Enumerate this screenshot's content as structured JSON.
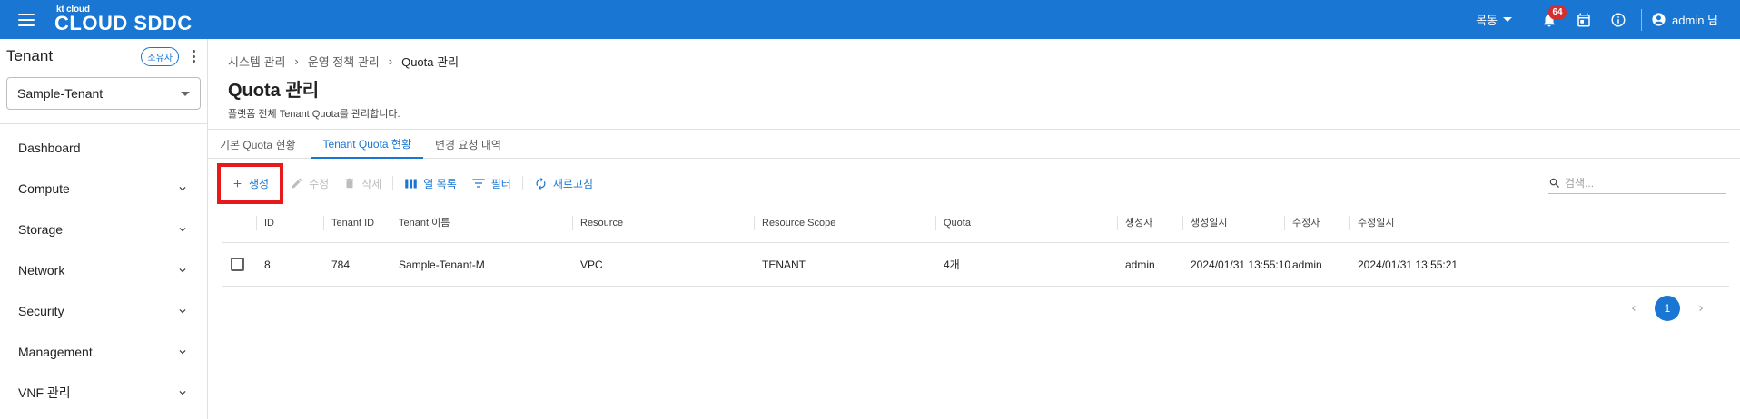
{
  "header": {
    "logo_small": "kt cloud",
    "logo_main": "CLOUD SDDC",
    "region": "목동",
    "notification_count": "64",
    "user_label": "admin 님"
  },
  "sidebar": {
    "title": "Tenant",
    "owner_chip": "소유자",
    "tenant_selected": "Sample-Tenant",
    "items": [
      {
        "label": "Dashboard",
        "expandable": false
      },
      {
        "label": "Compute",
        "expandable": true
      },
      {
        "label": "Storage",
        "expandable": true
      },
      {
        "label": "Network",
        "expandable": true
      },
      {
        "label": "Security",
        "expandable": true
      },
      {
        "label": "Management",
        "expandable": true
      },
      {
        "label": "VNF 관리",
        "expandable": true
      }
    ]
  },
  "breadcrumb": [
    "시스템 관리",
    "운영 정책 관리",
    "Quota 관리"
  ],
  "page": {
    "title": "Quota 관리",
    "description": "플랫폼 전체 Tenant Quota를 관리합니다."
  },
  "tabs": [
    "기본 Quota 현황",
    "Tenant Quota 현황",
    "변경 요청 내역"
  ],
  "toolbar": {
    "create": "생성",
    "edit": "수정",
    "delete": "삭제",
    "columns": "열 목록",
    "filter": "필터",
    "refresh": "새로고침",
    "search_placeholder": "검색..."
  },
  "table": {
    "columns": [
      "ID",
      "Tenant ID",
      "Tenant 이름",
      "Resource",
      "Resource Scope",
      "Quota",
      "생성자",
      "생성일시",
      "수정자",
      "수정일시"
    ],
    "rows": [
      [
        "8",
        "784",
        "Sample-Tenant-M",
        "VPC",
        "TENANT",
        "4개",
        "admin",
        "2024/01/31 13:55:10",
        "admin",
        "2024/01/31 13:55:21"
      ]
    ]
  },
  "pagination": {
    "current": "1"
  },
  "colors": {
    "primary": "#1976d2",
    "highlight": "#e8191d",
    "badge": "#d32f2f"
  }
}
